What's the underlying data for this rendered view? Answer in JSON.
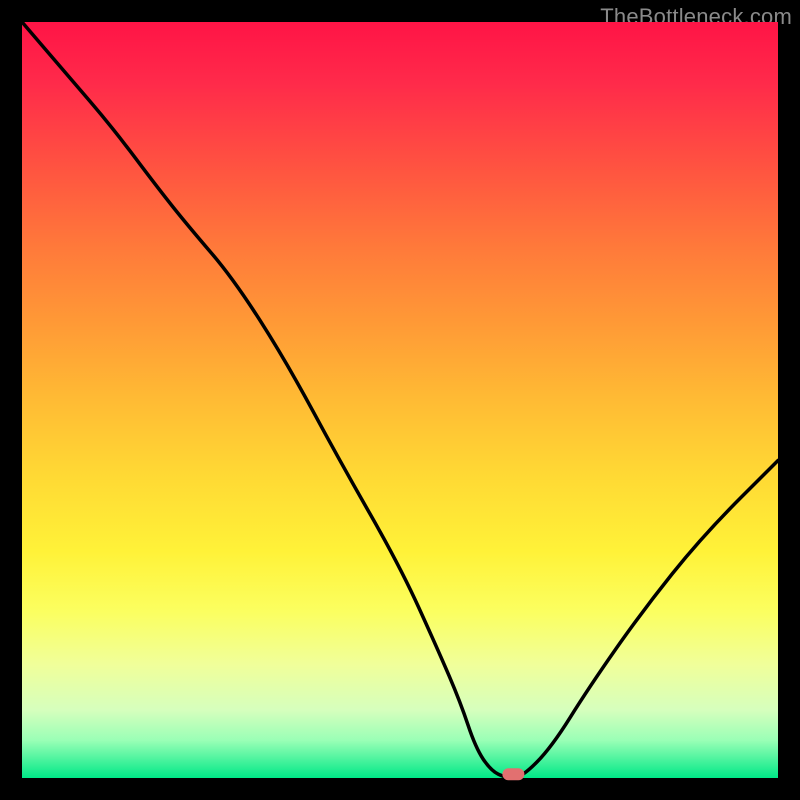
{
  "watermark": "TheBottleneck.com",
  "chart_data": {
    "type": "line",
    "title": "",
    "xlabel": "",
    "ylabel": "",
    "xlim": [
      0,
      100
    ],
    "ylim": [
      0,
      100
    ],
    "background": "gradient red→yellow→green (y=100→0)",
    "series": [
      {
        "name": "bottleneck-curve",
        "x": [
          0,
          6,
          12,
          18,
          22,
          28,
          35,
          42,
          50,
          55,
          58,
          60,
          62,
          64,
          66,
          70,
          75,
          82,
          90,
          100
        ],
        "y": [
          100,
          93,
          86,
          78,
          73,
          66,
          55,
          42,
          28,
          17,
          10,
          4,
          1,
          0,
          0,
          4,
          12,
          22,
          32,
          42
        ]
      }
    ],
    "marker": {
      "x": 65,
      "y": 0.5,
      "shape": "pill",
      "color": "#e27070"
    }
  },
  "colors": {
    "page_bg": "#000000",
    "watermark": "#8a8a8a",
    "curve": "#000000",
    "marker": "#e27070"
  }
}
